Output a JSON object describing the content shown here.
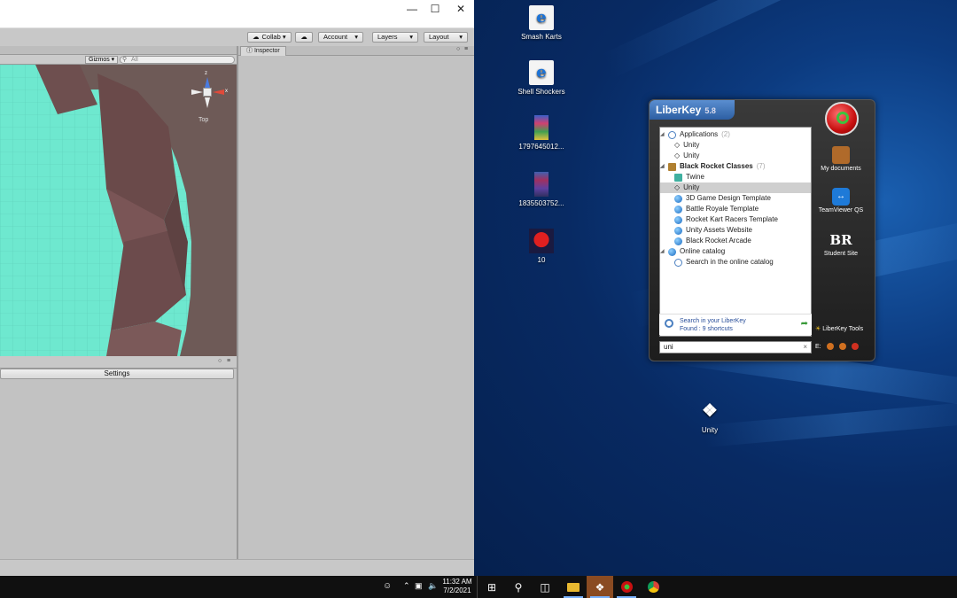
{
  "unity": {
    "toolbar": {
      "collab_label": "Collab ▾",
      "account_label": "Account",
      "layers_label": "Layers",
      "layout_label": "Layout"
    },
    "scene": {
      "gizmos_label": "Gizmos ▾",
      "search_placeholder": "All",
      "gizmo_view_label": "Top",
      "axis_y": "z",
      "axis_x": "x"
    },
    "inspector_tab": "Inspector",
    "settings_label": "Settings"
  },
  "desktop_icons": [
    {
      "label": "Smash Karts",
      "icon": "ie-shortcut-icon"
    },
    {
      "label": "Shell Shockers",
      "icon": "ie-shortcut-icon"
    },
    {
      "label": "1797645012...",
      "icon": "image-icon"
    },
    {
      "label": "1835503752...",
      "icon": "image-icon"
    },
    {
      "label": "10",
      "icon": "among-us-icon"
    },
    {
      "label": "Unity",
      "icon": "unity-icon"
    }
  ],
  "liberkey": {
    "title": "LiberKey",
    "version": "5.8",
    "items": [
      {
        "label": "Applications",
        "count": "(2)",
        "type": "cat"
      },
      {
        "label": "Unity",
        "type": "app"
      },
      {
        "label": "Unity",
        "type": "app"
      },
      {
        "label": "Black Rocket Classes",
        "count": "(7)",
        "type": "cat"
      },
      {
        "label": "Twine",
        "type": "app"
      },
      {
        "label": "Unity",
        "type": "app"
      },
      {
        "label": "3D Game Design Template",
        "type": "link"
      },
      {
        "label": "Battle Royale Template",
        "type": "link"
      },
      {
        "label": "Rocket Kart Racers Template",
        "type": "link"
      },
      {
        "label": "Unity Assets Website",
        "type": "link"
      },
      {
        "label": "Black Rocket Arcade",
        "type": "link"
      },
      {
        "label": "Online catalog",
        "type": "cat"
      },
      {
        "label": "Search in the online catalog",
        "type": "search"
      }
    ],
    "found_line1": "Search in your LiberKey",
    "found_line2": "Found : 9 shortcuts",
    "search_value": "uni",
    "side": [
      {
        "label": "My documents",
        "icon": "briefcase-icon"
      },
      {
        "label": "TeamViewer QS",
        "icon": "teamviewer-icon"
      },
      {
        "label": "Student Site",
        "icon": "br-logo-icon"
      }
    ],
    "tools_label": "LiberKey Tools",
    "drive_label": "E:"
  },
  "taskbar": {
    "time": "11:32 AM",
    "date": "7/2/2021"
  },
  "colors": {
    "scene_water": "#6ee8cf",
    "scene_terrain": "#6e4f4f",
    "desktop_blue": "#0c3b80",
    "taskbar": "#101010"
  }
}
